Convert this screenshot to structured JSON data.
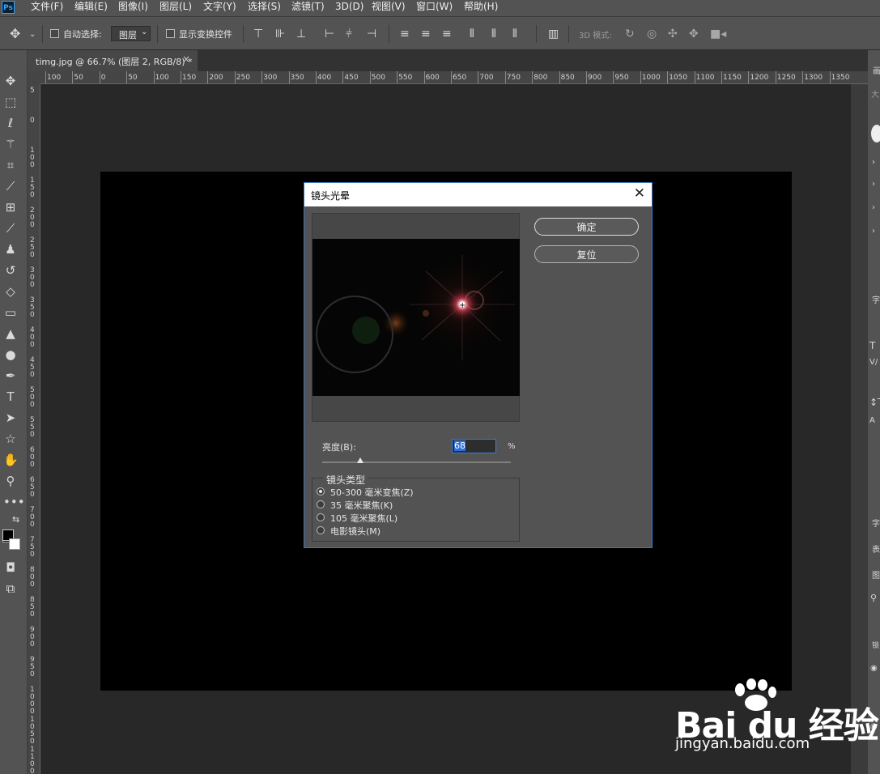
{
  "app": {
    "logo": "Ps"
  },
  "menu": [
    "文件(F)",
    "编辑(E)",
    "图像(I)",
    "图层(L)",
    "文字(Y)",
    "选择(S)",
    "滤镜(T)",
    "3D(D)",
    "视图(V)",
    "窗口(W)",
    "帮助(H)"
  ],
  "options": {
    "auto_select_label": "自动选择:",
    "auto_select_value": "图层",
    "show_transform_label": "显示变换控件",
    "mode3d_label": "3D 模式:"
  },
  "document_tab": {
    "title": "timg.jpg @ 66.7% (图层 2, RGB/8) *",
    "close": "×"
  },
  "ruler": {
    "h_ticks": [
      "100",
      "50",
      "0",
      "50",
      "100",
      "150",
      "200",
      "250",
      "300",
      "350",
      "400",
      "450",
      "500",
      "550",
      "600",
      "650",
      "700",
      "750",
      "800",
      "850",
      "900",
      "950",
      "1000",
      "1050",
      "1100",
      "1150",
      "1200",
      "1250",
      "1300",
      "1350"
    ],
    "v_ticks": [
      "5",
      "0",
      "1\n0\n0",
      "1\n5\n0",
      "2\n0\n0",
      "2\n5\n0",
      "3\n0\n0",
      "3\n5\n0",
      "4\n0\n0",
      "4\n5\n0",
      "5\n0\n0",
      "5\n5\n0",
      "6\n0\n0",
      "6\n5\n0",
      "7\n0\n0",
      "7\n5\n0",
      "8\n0\n0",
      "8\n5\n0",
      "9\n0\n0",
      "9\n5\n0",
      "1\n0\n0\n0",
      "1\n0\n5\n0",
      "1\n1\n0\n0"
    ]
  },
  "dialog": {
    "title": "镜头光晕",
    "close": "✕",
    "ok": "确定",
    "reset": "复位",
    "brightness_label": "亮度(B):",
    "brightness_value": "68",
    "brightness_percent": 68,
    "percent_sign": "%",
    "lens_group_title": "镜头类型",
    "lens_types": [
      {
        "label": "50-300 毫米变焦(Z)",
        "selected": true
      },
      {
        "label": "35 毫米聚焦(K)",
        "selected": false
      },
      {
        "label": "105 毫米聚焦(L)",
        "selected": false
      },
      {
        "label": "电影镜头(M)",
        "selected": false
      }
    ]
  },
  "right_panel": [
    "画",
    "大",
    "字",
    "字",
    "表",
    "图",
    "锁"
  ],
  "watermark": {
    "logo": "Bai du 经验",
    "url": "jingyan.baidu.com"
  },
  "colors": {
    "accent": "#3879c4",
    "panel": "#535353",
    "workspace": "#282828"
  }
}
